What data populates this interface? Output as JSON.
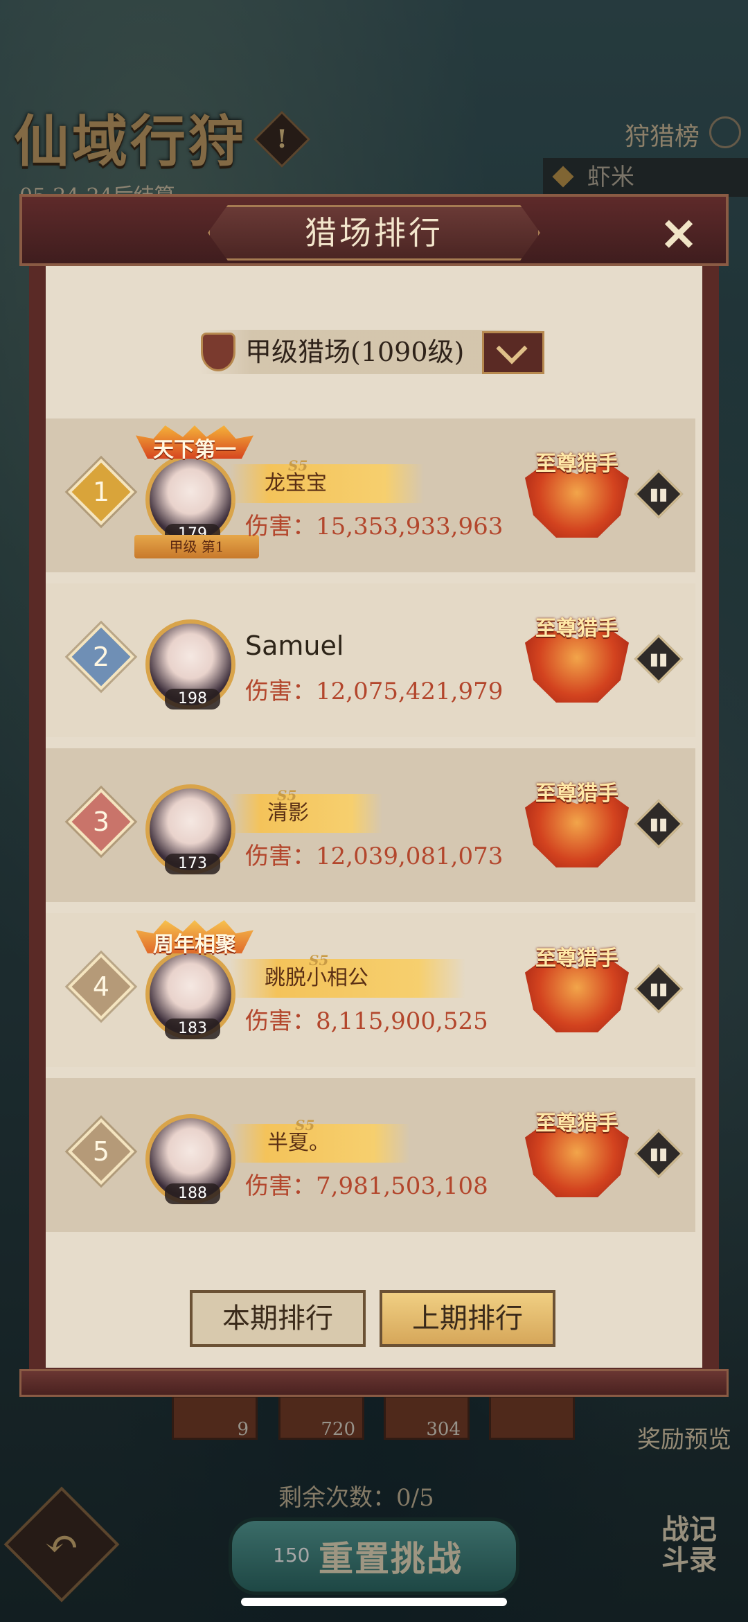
{
  "background": {
    "event_title": "仙域行狩",
    "countdown": "05:24:24后结算",
    "hunt_board_label": "狩猎榜",
    "top_player": "虾米",
    "reward_slots": [
      "9",
      "720",
      "304",
      ""
    ],
    "reward_preview_label": "奖励预览",
    "remaining_label": "剩余次数：0/5",
    "reset_cost": "150",
    "reset_label": "重置挑战",
    "battle_log_label": "战记斗录"
  },
  "modal": {
    "title": "猎场排行",
    "selector_label": "甲级猎场(1090级)",
    "tabs": {
      "current": "本期排行",
      "previous": "上期排行"
    },
    "rows": [
      {
        "rank": "1",
        "name": "龙宝宝",
        "level": "179",
        "damage": "伤害：15,353,933,963",
        "title": "至尊猎手",
        "banner": "天下第一",
        "ribbon": "甲级 第1",
        "season": "S5"
      },
      {
        "rank": "2",
        "name": "Samuel",
        "level": "198",
        "damage": "伤害：12,075,421,979",
        "title": "至尊猎手"
      },
      {
        "rank": "3",
        "name": "清影",
        "level": "173",
        "damage": "伤害：12,039,081,073",
        "title": "至尊猎手",
        "season": "S5"
      },
      {
        "rank": "4",
        "name": "跳脱小相公",
        "level": "183",
        "damage": "伤害：8,115,900,525",
        "title": "至尊猎手",
        "banner": "周年相聚",
        "season": "S5"
      },
      {
        "rank": "5",
        "name": "半夏。",
        "level": "188",
        "damage": "伤害：7,981,503,108",
        "title": "至尊猎手",
        "season": "S5"
      }
    ]
  },
  "colors": {
    "rank1": "#d9a43a",
    "rank2": "#6f8fb5",
    "rank3": "#c9746a",
    "rank_other": "#b59a78",
    "damage_text": "#b3462c",
    "modal_bg": "#e6dccb"
  },
  "icons": {
    "close": "close-icon",
    "dropdown": "chevron-down-icon",
    "stats": "bar-chart-icon",
    "back": "back-arrow-icon"
  }
}
